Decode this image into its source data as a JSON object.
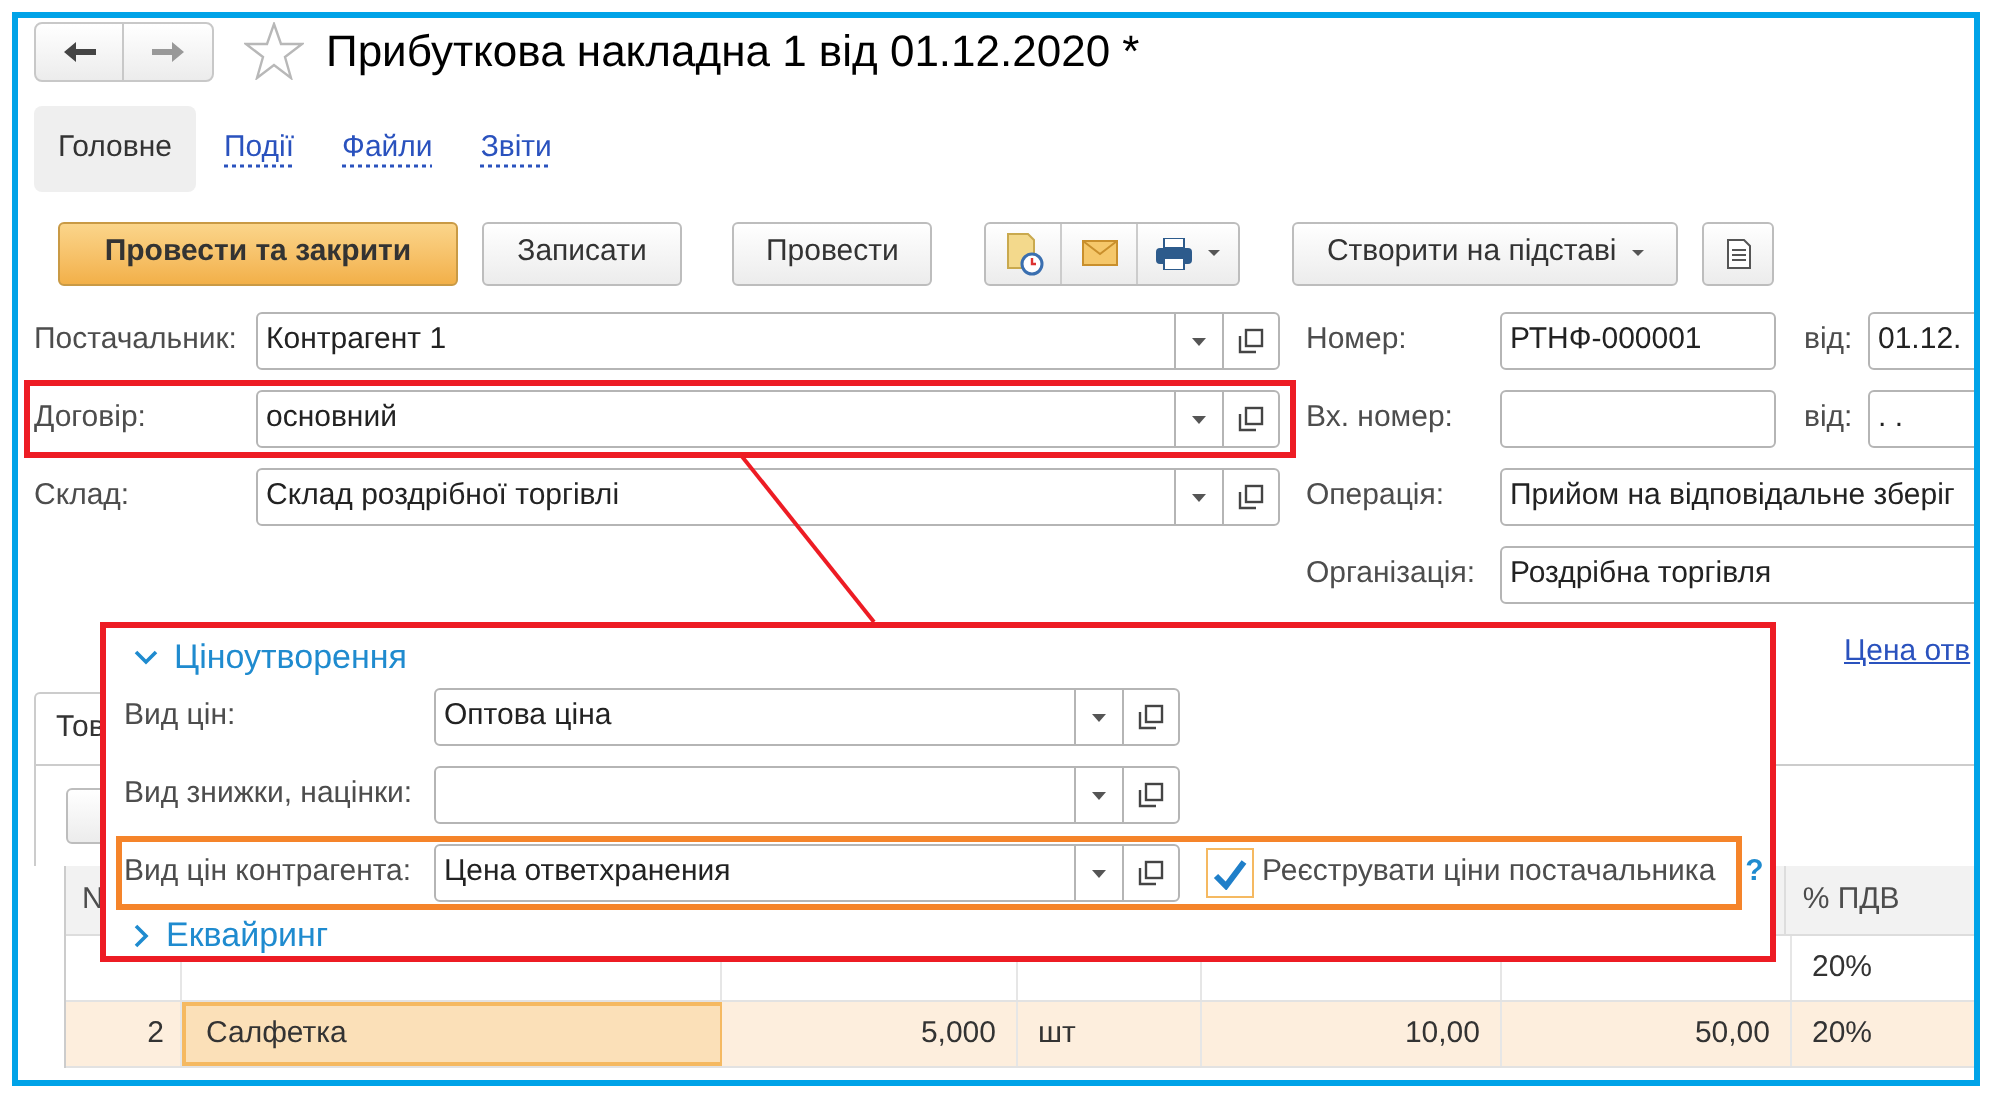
{
  "title": "Прибуткова накладна 1 від 01.12.2020 *",
  "tabs": [
    {
      "label": "Головне",
      "selected": true
    },
    {
      "label": "Події",
      "selected": false
    },
    {
      "label": "Файли",
      "selected": false
    },
    {
      "label": "Звіти",
      "selected": false
    }
  ],
  "buttons": [
    {
      "label": "Провести та закрити",
      "kind": "primary"
    },
    {
      "label": "Записати",
      "kind": "plain"
    },
    {
      "label": "Провести",
      "kind": "plain"
    },
    {
      "kind": "icons"
    },
    {
      "label": "Створити на підставі",
      "kind": "menu"
    },
    {
      "kind": "document"
    }
  ],
  "left_fields": [
    {
      "label": "Постачальник:",
      "value": "Контрагент 1",
      "highlighted": false
    },
    {
      "label": "Договір:",
      "value": "основний",
      "highlighted": true
    },
    {
      "label": "Склад:",
      "value": "Склад роздрібної торгівлі",
      "highlighted": false
    }
  ],
  "right_fields": [
    {
      "label": "Номер:",
      "value": "РТНФ-000001",
      "date_label": "від:",
      "date": "01.12."
    },
    {
      "label": "Вх. номер:",
      "date_label": "від:",
      "date": ". ."
    },
    {
      "label": "Операція:",
      "value": "Прийом на відповідальне зберіг"
    },
    {
      "label": "Організація:",
      "value": "Роздрібна торгівля"
    }
  ],
  "price_link": "Цена отв",
  "table": {
    "tab": "Тов",
    "header": {
      "number": "N",
      "vat": "% ПДВ"
    },
    "rows": [
      {
        "vat": "20%",
        "selected": false
      },
      {
        "n": "2",
        "name": "Салфетка",
        "qty": "5,000",
        "unit": "шт",
        "price": "10,00",
        "sum": "50,00",
        "vat": "20%",
        "selected": true
      }
    ]
  },
  "popup": {
    "sections": [
      {
        "title": "Ціноутворення",
        "expanded": true,
        "fields": [
          {
            "label": "Вид цін:",
            "value": "Оптова ціна",
            "highlighted": false
          },
          {
            "label": "Вид знижки, націнки:",
            "highlighted": false
          },
          {
            "label": "Вид цін контрагента:",
            "value": "Цена ответхранения",
            "highlighted": true,
            "checkbox": {
              "label": "Реєструвати ціни постачальника",
              "checked": true
            },
            "help": "?"
          }
        ]
      },
      {
        "title": "Еквайринг",
        "expanded": false
      }
    ]
  }
}
